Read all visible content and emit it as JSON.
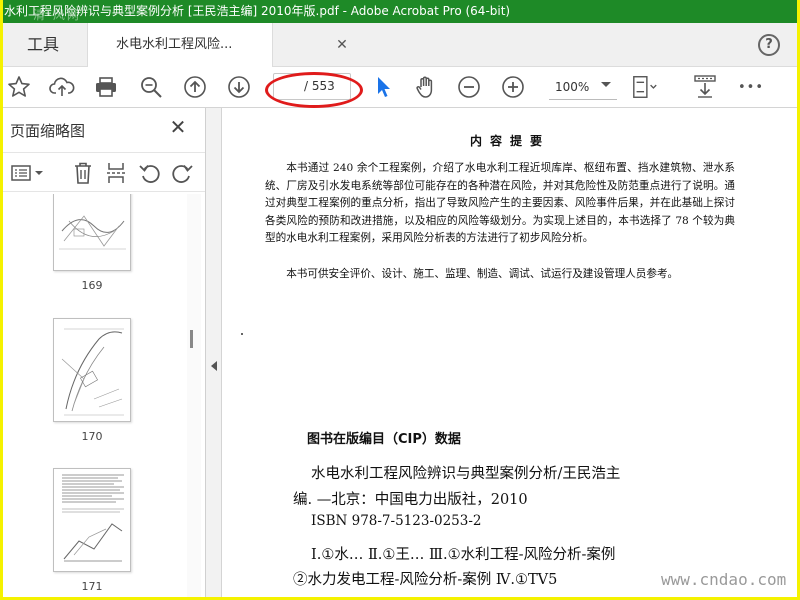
{
  "window": {
    "title": "水利工程风险辨识与典型案例分析 [王民浩主编] 2010年版.pdf - Adobe Acrobat Pro (64-bit)"
  },
  "tabs": {
    "tools_label": "工具",
    "doc_label": "水电水利工程风险...",
    "close_glyph": "✕",
    "help_glyph": "?"
  },
  "toolbar": {
    "icons": [
      "star-icon",
      "cloud-upload-icon",
      "printer-icon",
      "zoom-search-icon",
      "page-up-icon",
      "page-down-icon",
      "select-cursor-icon",
      "hand-tool-icon",
      "zoom-out-icon",
      "zoom-in-icon",
      "page-fit-icon",
      "scroll-mode-icon",
      "more-icon"
    ],
    "page_current": "",
    "page_total": "/ 553",
    "zoom": "100%",
    "more_glyph": "•••"
  },
  "sidebar": {
    "title": "页面缩略图",
    "close_glyph": "✕",
    "thumbnails": [
      {
        "label": "169"
      },
      {
        "label": "170"
      },
      {
        "label": "171"
      }
    ]
  },
  "document": {
    "heading": "内容提要",
    "paragraph1": "本书通过 240 余个工程案例，介绍了水电水利工程近坝库岸、枢纽布置、挡水建筑物、泄水系统、厂房及引水发电系统等部位可能存在的各种潜在风险，并对其危险性及防范重点进行了说明。通过对典型工程案例的重点分析，指出了导致风险产生的主要因素、风险事件后果，并在此基础上探讨各类风险的预防和改进措施，以及相应的风险等级划分。为实现上述目的，本书选择了 78 个较为典型的水电水利工程案例，采用风险分析表的方法进行了初步风险分析。",
    "paragraph2": "本书可供安全评价、设计、施工、监理、制造、调试、试运行及建设管理人员参考。",
    "cip_title": "图书在版编目（CIP）数据",
    "cip_line1": "水电水利工程风险辨识与典型案例分析/王民浩主",
    "cip_line2": "编. —北京：中国电力出版社，2010",
    "cip_line3": "ISBN 978-7-5123-0253-2",
    "cip_line4": "Ⅰ.①水…  Ⅱ.①王…  Ⅲ.①水利工程-风险分析-案例",
    "cip_line5": "②水力发电工程-风险分析-案例  Ⅳ.①TV5"
  },
  "watermarks": {
    "top_left": "清·风网",
    "bottom_right": "www.cndao.com"
  },
  "colors": {
    "title_bar": "#1e8a27",
    "frame_border": "#f5f200",
    "annotation_ellipse": "#e01b1b",
    "cursor_blue": "#1a73e8"
  }
}
